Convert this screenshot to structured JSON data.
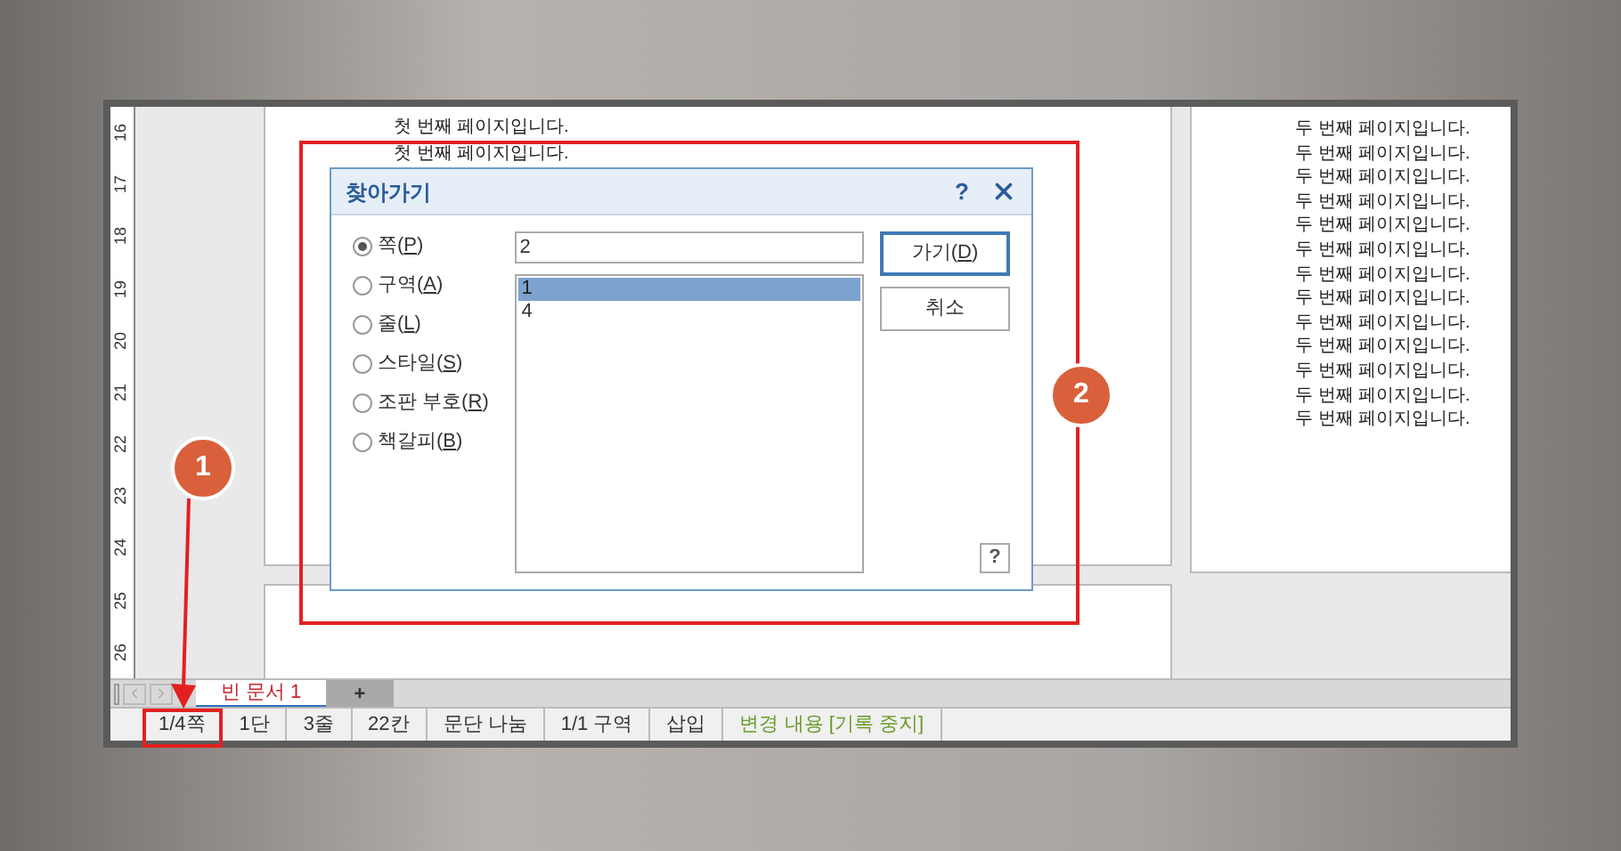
{
  "ruler": {
    "marks": [
      "16",
      "17",
      "18",
      "19",
      "20",
      "21",
      "22",
      "23",
      "24",
      "25",
      "26"
    ]
  },
  "pages": [
    {
      "lines": [
        "첫 번째 페이지입니다.",
        "첫 번째 페이지입니다."
      ]
    },
    {
      "lines": [
        "두 번째 페이지입니다.",
        "두 번째 페이지입니다.",
        "두 번째 페이지입니다.",
        "두 번째 페이지입니다.",
        "두 번째 페이지입니다.",
        "두 번째 페이지입니다.",
        "두 번째 페이지입니다.",
        "두 번째 페이지입니다.",
        "두 번째 페이지입니다.",
        "두 번째 페이지입니다.",
        "두 번째 페이지입니다.",
        "두 번째 페이지입니다.",
        "두 번째 페이지입니다."
      ]
    }
  ],
  "dialog": {
    "title": "찾아가기",
    "help": "?",
    "options": [
      {
        "prefix": "쪽(",
        "access_key": "P",
        "suffix": ")",
        "selected": true
      },
      {
        "prefix": "구역(",
        "access_key": "A",
        "suffix": ")",
        "selected": false
      },
      {
        "prefix": "줄(",
        "access_key": "L",
        "suffix": ")",
        "selected": false
      },
      {
        "prefix": "스타일(",
        "access_key": "S",
        "suffix": ")",
        "selected": false
      },
      {
        "prefix": "조판 부호(",
        "access_key": "R",
        "suffix": ")",
        "selected": false
      },
      {
        "prefix": "책갈피(",
        "access_key": "B",
        "suffix": ")",
        "selected": false
      }
    ],
    "value": "2",
    "list": [
      {
        "text": "1",
        "selected": true
      },
      {
        "text": "4",
        "selected": false
      }
    ],
    "buttons": [
      {
        "prefix": "가기(",
        "access_key": "D",
        "suffix": ")",
        "default": true
      },
      {
        "prefix": "취소",
        "default": false
      }
    ],
    "help_button": "?"
  },
  "tabs": [
    {
      "label": "빈 문서 1",
      "selected": true
    },
    {
      "label": "+",
      "selected": false
    }
  ],
  "status_bar": [
    {
      "text": "1/4쪽",
      "color": "#333333"
    },
    {
      "text": "1단",
      "color": "#333333"
    },
    {
      "text": "3줄",
      "color": "#333333"
    },
    {
      "text": "22칸",
      "color": "#333333"
    },
    {
      "text": "문단 나눔",
      "color": "#333333"
    },
    {
      "text": "1/1 구역",
      "color": "#333333"
    },
    {
      "text": "삽입",
      "color": "#333333"
    },
    {
      "text": "변경 내용 [기록 중지]",
      "color": "#6a9a2a"
    }
  ],
  "callouts": [
    {
      "number": "1"
    },
    {
      "number": "2"
    }
  ]
}
